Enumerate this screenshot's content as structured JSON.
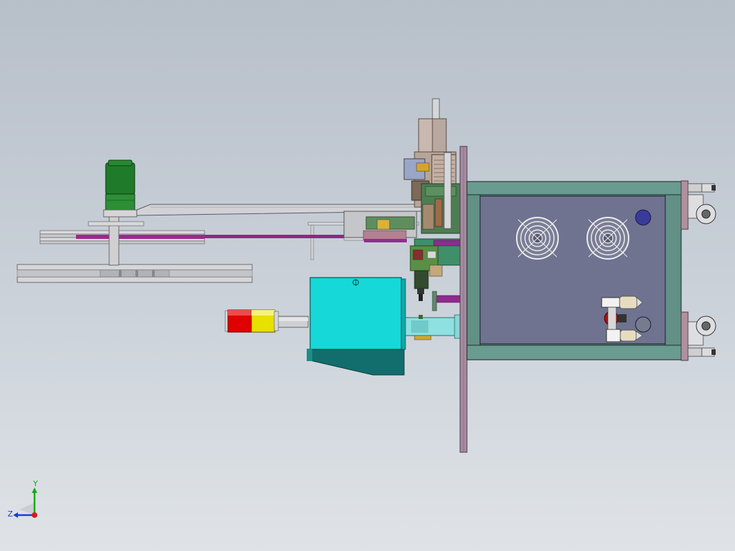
{
  "view": {
    "triad": {
      "y_label": "Y",
      "z_label": "Z"
    },
    "colors": {
      "background_top": "#b7bfc9",
      "background_bottom": "#dfe3e7",
      "cabinet_frame": "#5d8a80",
      "cabinet_panel": "#6f7390",
      "motor_green": "#1f7a2a",
      "cyan_block": "#16d8d8",
      "signal_red": "#e00000",
      "signal_yellow": "#e8e000",
      "magenta_rod": "#a02890"
    }
  }
}
